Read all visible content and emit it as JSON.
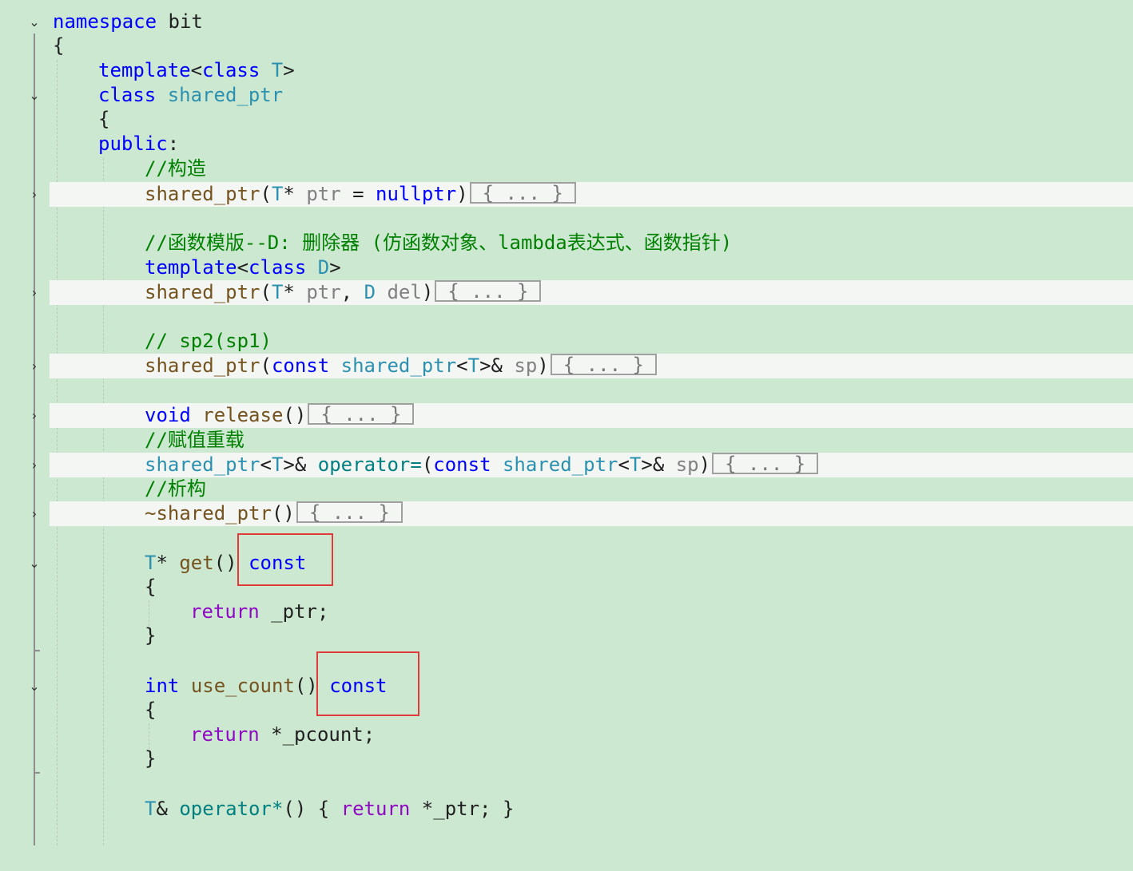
{
  "editor": {
    "annotation_color": "#e03a3a",
    "colors": {
      "keyword": "#0000ff",
      "type": "#2b91af",
      "function": "#74531f",
      "comment": "#008000",
      "control": "#8f08c4",
      "param": "#808080"
    },
    "collapsed_placeholder": "{ ... }",
    "lines": {
      "l1": {
        "kw": "namespace",
        "name": "bit"
      },
      "l2": "{",
      "l3": {
        "kw": "template",
        "lt": "<",
        "cls": "class",
        "sp": " ",
        "t": "T",
        "gt": ">"
      },
      "l4": {
        "kw": "class",
        "sp": " ",
        "name": "shared_ptr"
      },
      "l5": "{",
      "l6": {
        "kw": "public",
        "colon": ":"
      },
      "l7": "//构造",
      "l8": {
        "fn": "shared_ptr",
        "lp": "(",
        "t": "T",
        "star": "* ",
        "p": "ptr",
        "eq": " = ",
        "np": "nullptr",
        "rp": ")"
      },
      "l9": "//函数模版--D: 删除器 (仿函数对象、lambda表达式、函数指针)",
      "l10": {
        "kw": "template",
        "lt": "<",
        "cls": "class",
        "sp": " ",
        "t": "D",
        "gt": ">"
      },
      "l11": {
        "fn": "shared_ptr",
        "lp": "(",
        "t": "T",
        "star": "* ",
        "p": "ptr",
        "comma": ", ",
        "d": "D",
        "sp": " ",
        "p2": "del",
        "rp": ")"
      },
      "l12": "// sp2(sp1)",
      "l13": {
        "fn": "shared_ptr",
        "lp": "(",
        "c": "const",
        "sp": " ",
        "tn": "shared_ptr",
        "lt": "<",
        "t": "T",
        "gtamp": ">& ",
        "p": "sp",
        "rp": ")"
      },
      "l14": {
        "kw": "void",
        "sp": " ",
        "fn": "release",
        "par": "()"
      },
      "l15": "//赋值重载",
      "l16": {
        "tn": "shared_ptr",
        "lt": "<",
        "t": "T",
        "gtamp": ">& ",
        "op": "operator=",
        "lp": "(",
        "c": "const",
        "sp": " ",
        "tn2": "shared_ptr",
        "lt2": "<",
        "t2": "T",
        "gtamp2": ">& ",
        "p": "sp",
        "rp": ")"
      },
      "l17": "//析构",
      "l18": {
        "fn": "~shared_ptr",
        "par": "()"
      },
      "l19": {
        "t": "T",
        "star": "* ",
        "fn": "get",
        "par": "() ",
        "c": "const"
      },
      "l20": "{",
      "l21": {
        "ret": "return",
        "rest": " _ptr;"
      },
      "l22": "}",
      "l23": {
        "kw": "int",
        "sp": " ",
        "fn": "use_count",
        "par": "() ",
        "c": "const"
      },
      "l24": "{",
      "l25": {
        "ret": "return",
        "rest": " *_pcount;"
      },
      "l26": "}",
      "l27": {
        "t": "T",
        "amp": "& ",
        "op": "operator*",
        "rest1": "() { ",
        "ret": "return",
        "rest2": " *_ptr; }"
      }
    }
  }
}
